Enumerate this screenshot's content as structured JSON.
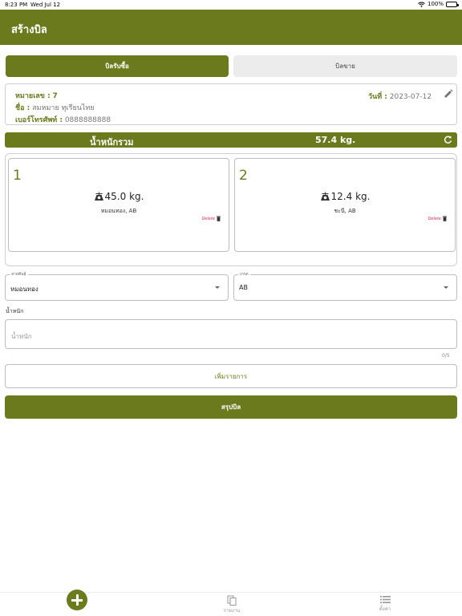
{
  "status": {
    "time": "8:23 PM",
    "date": "Wed Jul 12",
    "battery": "100%"
  },
  "appbar": {
    "title": "สร้างบิล"
  },
  "segment": {
    "buy_label": "บิลรับซื้อ",
    "sell_label": "บิลขาย"
  },
  "bill": {
    "number_label": "หมายเลข :",
    "number": "7",
    "name_label": "ชื่อ :",
    "name": "สมหมาย ทุเรียนไทย",
    "phone_label": "เบอร์โทรศัพท์ :",
    "phone": "0888888888",
    "date_label": "วันที่ :",
    "date": "2023-07-12"
  },
  "total": {
    "label": "น้ำหนักรวม",
    "value": "57.4 kg."
  },
  "items": [
    {
      "index": "1",
      "weight": "45.0 kg.",
      "desc": "หมอนทอง, AB",
      "delete_label": "Delete"
    },
    {
      "index": "2",
      "weight": "12.4 kg.",
      "desc": "ชะนี, AB",
      "delete_label": "Delete"
    }
  ],
  "form": {
    "variety_label": "สายพันธุ์",
    "variety_value": "หมอนทอง",
    "grade_label": "เกรด",
    "grade_value": "AB",
    "weight_label": "น้ำหนัก",
    "weight_placeholder": "น้ำหนัก",
    "counter": "0/5"
  },
  "buttons": {
    "add_item": "เพิ่มรายการ",
    "summary": "สรุปบิล"
  },
  "tabbar": {
    "report_label": "รายงาน",
    "settings_label": "ตั้งค่า"
  },
  "colors": {
    "brand": "#6b7a1c",
    "delete": "#e0285a"
  }
}
